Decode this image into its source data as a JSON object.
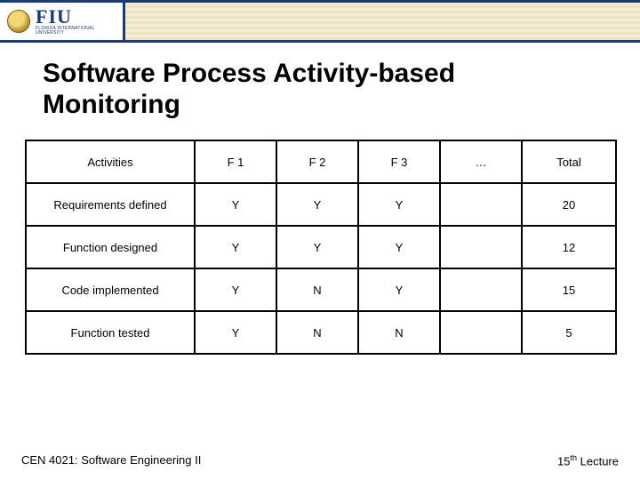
{
  "header": {
    "logo_text": "FIU",
    "logo_sub": "FLORIDA INTERNATIONAL UNIVERSITY"
  },
  "title_line1": "Software Process Activity-based",
  "title_line2": "Monitoring",
  "table": {
    "headers": {
      "activities": "Activities",
      "f1": "F 1",
      "f2": "F 2",
      "f3": "F 3",
      "dots": "…",
      "total": "Total"
    },
    "rows": [
      {
        "activity": "Requirements defined",
        "f1": "Y",
        "f2": "Y",
        "f3": "Y",
        "dots": "",
        "total": "20"
      },
      {
        "activity": "Function designed",
        "f1": "Y",
        "f2": "Y",
        "f3": "Y",
        "dots": "",
        "total": "12"
      },
      {
        "activity": "Code implemented",
        "f1": "Y",
        "f2": "N",
        "f3": "Y",
        "dots": "",
        "total": "15"
      },
      {
        "activity": "Function tested",
        "f1": "Y",
        "f2": "N",
        "f3": "N",
        "dots": "",
        "total": "5"
      }
    ]
  },
  "footer": {
    "left": "CEN 4021: Software Engineering II",
    "right_prefix": "15",
    "right_sup": "th",
    "right_suffix": " Lecture"
  }
}
